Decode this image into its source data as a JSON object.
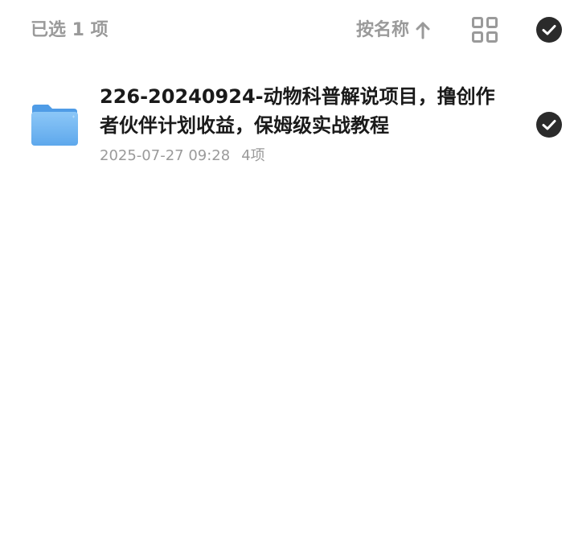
{
  "header": {
    "selected_count_label": "已选 1 项",
    "sort_label": "按名称",
    "sort_direction_icon": "arrow-up-icon",
    "view_toggle_icon": "grid-view-icon",
    "select_all_icon": "check-circle-icon",
    "select_all_checked": true
  },
  "files": [
    {
      "name": "226-20240924-动物科普解说项目，撸创作者伙伴计划收益，保姆级实战教程",
      "date": "2025-07-27 09:28",
      "item_count": "4项",
      "icon": "folder-icon",
      "selected": true
    }
  ],
  "colors": {
    "folder_blue": "#6cb4f2",
    "check_fill": "#2b2b2b",
    "muted_text": "#9a9a9a",
    "primary_text": "#1a1a1a"
  }
}
